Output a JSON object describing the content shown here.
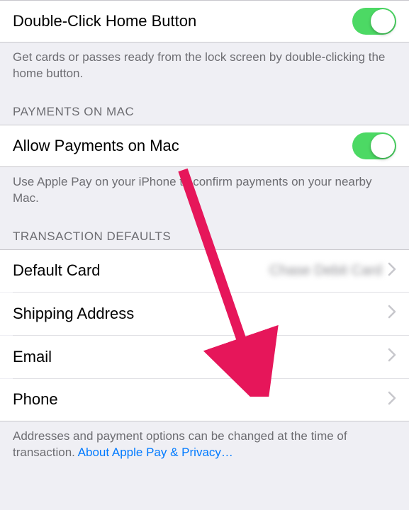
{
  "doubleClick": {
    "title": "Double-Click Home Button",
    "footer": "Get cards or passes ready from the lock screen by double-clicking the home button.",
    "switch_on": true
  },
  "paymentsOnMac": {
    "header": "PAYMENTS ON MAC",
    "title": "Allow Payments on Mac",
    "footer": "Use Apple Pay on your iPhone to confirm payments on your nearby Mac.",
    "switch_on": true
  },
  "transactionDefaults": {
    "header": "TRANSACTION DEFAULTS",
    "rows": {
      "defaultCard": {
        "label": "Default Card",
        "value": "Chase Debit Card"
      },
      "shipping": {
        "label": "Shipping Address"
      },
      "email": {
        "label": "Email"
      },
      "phone": {
        "label": "Phone"
      }
    },
    "footer_plain": "Addresses and payment options can be changed at the time of transaction. ",
    "footer_link": "About Apple Pay & Privacy…"
  },
  "colors": {
    "switch_on": "#4cd964",
    "link": "#007aff",
    "annotation_arrow": "#e6165a"
  }
}
